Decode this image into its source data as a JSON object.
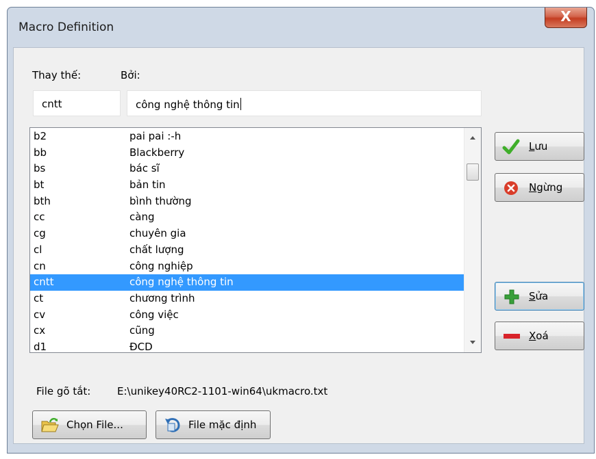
{
  "window": {
    "title": "Macro Definition",
    "close_label": "X"
  },
  "labels": {
    "replace": "Thay thế:",
    "by": "Bởi:"
  },
  "inputs": {
    "replace_value": "cntt",
    "by_value": "công nghệ thông tin"
  },
  "macros": [
    {
      "key": "b2",
      "value": "pai pai :-h"
    },
    {
      "key": "bb",
      "value": "Blackberry"
    },
    {
      "key": "bs",
      "value": "bác sĩ"
    },
    {
      "key": "bt",
      "value": "bản tin"
    },
    {
      "key": "bth",
      "value": "bình thường"
    },
    {
      "key": "cc",
      "value": "càng"
    },
    {
      "key": "cg",
      "value": "chuyên gia"
    },
    {
      "key": "cl",
      "value": "chất lượng"
    },
    {
      "key": "cn",
      "value": "công nghiệp"
    },
    {
      "key": "cntt",
      "value": "công nghệ thông tin"
    },
    {
      "key": "ct",
      "value": "chương trình"
    },
    {
      "key": "cv",
      "value": "công việc"
    },
    {
      "key": "cx",
      "value": "cũng"
    },
    {
      "key": "d1",
      "value": "ĐCD"
    }
  ],
  "selected_index": 9,
  "buttons": {
    "save": {
      "accel": "L",
      "rest": "ưu"
    },
    "cancel": {
      "accel": "N",
      "rest": "gừng"
    },
    "edit": {
      "accel": "S",
      "rest": "ửa"
    },
    "delete": {
      "accel": "X",
      "rest": "oá"
    },
    "choose_file": "Chọn File...",
    "default_file": "File mặc định"
  },
  "file": {
    "label": "File gõ tắt:",
    "path": "E:\\unikey40RC2-1101-win64\\ukmacro.txt"
  },
  "colors": {
    "selection": "#3399ff",
    "check_green": "#3fae2a",
    "cancel_red": "#d93d2a",
    "plus_green": "#39a03a",
    "minus_red": "#d8232a"
  }
}
